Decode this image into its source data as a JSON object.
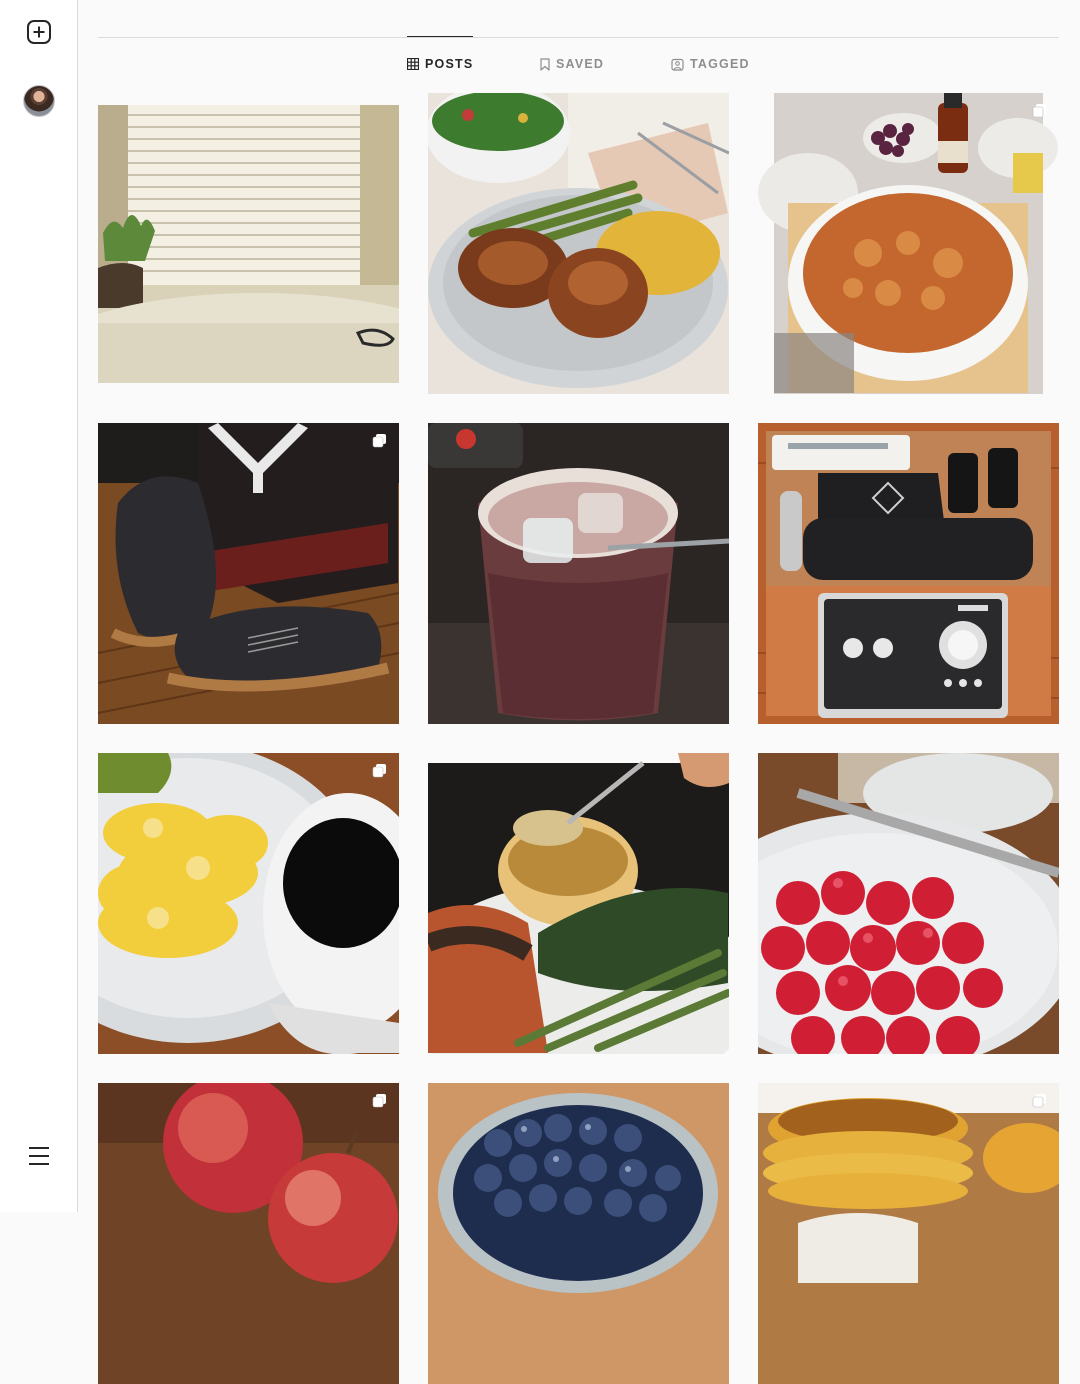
{
  "sidebar": {
    "new_post_icon": "plus-square-icon",
    "profile_icon": "avatar",
    "menu_icon": "hamburger-menu-icon"
  },
  "tabs": [
    {
      "label": "POSTS",
      "icon": "grid-icon",
      "active": true
    },
    {
      "label": "SAVED",
      "icon": "bookmark-icon",
      "active": false
    },
    {
      "label": "TAGGED",
      "icon": "tagged-user-icon",
      "active": false
    }
  ],
  "posts": [
    {
      "subject": "window-blinds-sunlight",
      "multiple": false
    },
    {
      "subject": "chicken-asparagus-rice-plate",
      "multiple": false
    },
    {
      "subject": "baked-bread-pudding",
      "multiple": true
    },
    {
      "subject": "black-sneakers-with-box",
      "multiple": true
    },
    {
      "subject": "iced-drink-glass",
      "multiple": false
    },
    {
      "subject": "microphone-audio-interface-box",
      "multiple": false
    },
    {
      "subject": "scrambled-eggs-coffee",
      "multiple": true
    },
    {
      "subject": "salmon-sauce-asparagus",
      "multiple": false
    },
    {
      "subject": "raspberries-plate",
      "multiple": false
    },
    {
      "subject": "red-apples",
      "multiple": true
    },
    {
      "subject": "blueberries-bowl",
      "multiple": false
    },
    {
      "subject": "pancakes-stack",
      "multiple": true
    }
  ],
  "colors": {
    "background": "#fafafa",
    "border": "#dbdbdb",
    "active_tab": "#262626",
    "inactive_tab": "#8e8e8e"
  }
}
